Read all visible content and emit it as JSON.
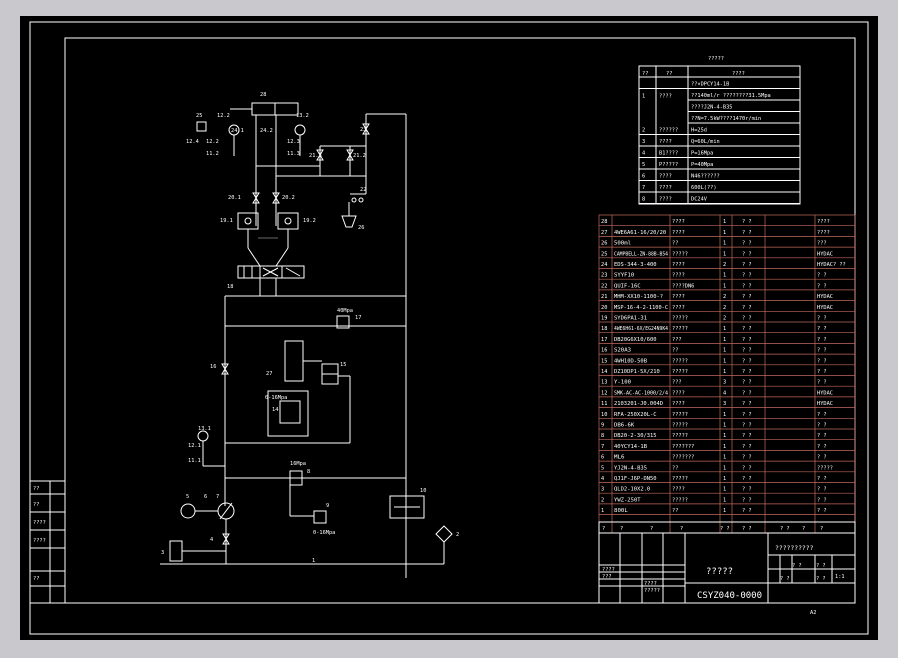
{
  "drawing": {
    "sheet_size": "A2",
    "number": "CSYZ040-0000",
    "title": "?????",
    "subtitle": "??????????"
  },
  "specs": {
    "title": "?????",
    "header": [
      "??",
      "??",
      "????"
    ],
    "rows": [
      {
        "no": "1",
        "name": "????",
        "value": "??×DPCY14-1B"
      },
      {
        "no": "",
        "name": "",
        "value": "??140ml/r ????????31.5Mpa"
      },
      {
        "no": "",
        "name": "",
        "value": "????J2N-4-B35"
      },
      {
        "no": "",
        "name": "",
        "value": "??N=7.5kW????1470r/min"
      },
      {
        "no": "2",
        "name": "??????",
        "value": "H=25d"
      },
      {
        "no": "3",
        "name": "????",
        "value": "Q=60L/min"
      },
      {
        "no": "4",
        "name": "B1????",
        "value": "P=16Mpa"
      },
      {
        "no": "5",
        "name": "P?????",
        "value": "P=40Mpa"
      },
      {
        "no": "6",
        "name": "????",
        "value": "N46??????"
      },
      {
        "no": "7",
        "name": "????",
        "value": "600L(??)"
      },
      {
        "no": "8",
        "name": "????",
        "value": "DC24V"
      }
    ]
  },
  "bom": [
    {
      "no": "28",
      "code": "",
      "name": "????",
      "qty": "1",
      "mat": "? ?",
      "note": "????"
    },
    {
      "no": "27",
      "code": "4WE6A61-16/20/20",
      "name": "????",
      "qty": "1",
      "mat": "? ?",
      "note": "????"
    },
    {
      "no": "26",
      "code": "500ml",
      "name": "??",
      "qty": "1",
      "mat": "? ?",
      "note": "???"
    },
    {
      "no": "25",
      "code": "CAMPBELL-ZN-88B-B54",
      "name": "?????",
      "qty": "1",
      "mat": "? ?",
      "note": "HYDAC"
    },
    {
      "no": "24",
      "code": "EDS-344-3-400",
      "name": "????",
      "qty": "2",
      "mat": "? ?",
      "note": "HYDAC? ??"
    },
    {
      "no": "23",
      "code": "SYYF10",
      "name": "????",
      "qty": "1",
      "mat": "? ?",
      "note": "? ?"
    },
    {
      "no": "22",
      "code": "QUIF-16C",
      "name": "????DN6",
      "qty": "1",
      "mat": "? ?",
      "note": "? ?"
    },
    {
      "no": "21",
      "code": "MHM-XX10-1100-?",
      "name": "????",
      "qty": "2",
      "mat": "? ?",
      "note": "HYDAC"
    },
    {
      "no": "20",
      "code": "MSP-16-4-2-1100-C",
      "name": "????",
      "qty": "2",
      "mat": "? ?",
      "note": "HYDAC"
    },
    {
      "no": "19",
      "code": "SYD6PA1-31",
      "name": "?????",
      "qty": "2",
      "mat": "? ?",
      "note": "? ?"
    },
    {
      "no": "18",
      "code": "4WE6H61-6X/EG24N9K4",
      "name": "?????",
      "qty": "1",
      "mat": "? ?",
      "note": "? ?"
    },
    {
      "no": "17",
      "code": "DB20G6X10/600",
      "name": "???",
      "qty": "1",
      "mat": "? ?",
      "note": "? ?"
    },
    {
      "no": "16",
      "code": "S20A3",
      "name": "??",
      "qty": "1",
      "mat": "? ?",
      "note": "? ?"
    },
    {
      "no": "15",
      "code": "4WH10D-50B",
      "name": "?????",
      "qty": "1",
      "mat": "? ?",
      "note": "? ?"
    },
    {
      "no": "14",
      "code": "DZ10DP1-5X/210",
      "name": "?????",
      "qty": "1",
      "mat": "? ?",
      "note": "? ?"
    },
    {
      "no": "13",
      "code": "Y-100",
      "name": "???",
      "qty": "3",
      "mat": "? ?",
      "note": "? ?"
    },
    {
      "no": "12",
      "code": "SMK-AC-AC-1000/2/4",
      "name": "????",
      "qty": "4",
      "mat": "? ?",
      "note": "HYDAC"
    },
    {
      "no": "11",
      "code": "2103201-J0.004D",
      "name": "????",
      "qty": "3",
      "mat": "? ?",
      "note": "HYDAC"
    },
    {
      "no": "10",
      "code": "RFA-250X20L-C",
      "name": "?????",
      "qty": "1",
      "mat": "? ?",
      "note": "? ?"
    },
    {
      "no": "9",
      "code": "DB6-6K",
      "name": "?????",
      "qty": "1",
      "mat": "? ?",
      "note": "? ?"
    },
    {
      "no": "8",
      "code": "DB20-2-30/315",
      "name": "?????",
      "qty": "1",
      "mat": "? ?",
      "note": "? ?"
    },
    {
      "no": "7",
      "code": "40YCY14-1B",
      "name": "???????",
      "qty": "1",
      "mat": "? ?",
      "note": "? ?"
    },
    {
      "no": "6",
      "code": "ML6",
      "name": "???????",
      "qty": "1",
      "mat": "? ?",
      "note": "? ?"
    },
    {
      "no": "5",
      "code": "YJ2N-4-B35",
      "name": "??",
      "qty": "1",
      "mat": "? ?",
      "note": "?????"
    },
    {
      "no": "4",
      "code": "QJ1F-J6P-DN50",
      "name": "?????",
      "qty": "1",
      "mat": "? ?",
      "note": "? ?"
    },
    {
      "no": "3",
      "code": "QLD2-10X2.0",
      "name": "????",
      "qty": "1",
      "mat": "? ?",
      "note": "? ?"
    },
    {
      "no": "2",
      "code": "YWZ-250T",
      "name": "?????",
      "qty": "1",
      "mat": "? ?",
      "note": "? ?"
    },
    {
      "no": "1",
      "code": "800L",
      "name": "??",
      "qty": "1",
      "mat": "? ?",
      "note": "? ?"
    }
  ],
  "bom_header": [
    "?",
    "?",
    "?",
    "?",
    "? ?",
    "? ?",
    "? ?",
    "?",
    "?"
  ],
  "title_block": {
    "rows_left": [
      "??",
      "??",
      "??",
      "??",
      "??"
    ],
    "misc": [
      "????",
      "???",
      "????",
      "?????"
    ],
    "right": [
      "? ?",
      "? ?",
      "? ?",
      "? ?"
    ],
    "sheet": "1:1",
    "page": "A2"
  },
  "left_block": [
    "??",
    "??",
    "????",
    "????",
    "??"
  ],
  "labels": {
    "l28": "28",
    "l25": "25",
    "l124": "12.4",
    "l122": "12.2",
    "l132": "13.2",
    "l242": "24.2",
    "l241": "24.1",
    "l123": "12.3",
    "l131": "13.1",
    "l121": "12.1",
    "l112": "11.2",
    "l113": "11.3",
    "l213": "21.3",
    "l212": "21.2",
    "l23": "23",
    "l22": "22",
    "l26": "26",
    "l201": "20.1",
    "l202": "20.2",
    "l191": "19.1",
    "l192": "19.2",
    "l18": "18",
    "p40": "40Mpa",
    "l17": "17",
    "l16": "16",
    "l27": "27",
    "l15": "15",
    "p016a": "0-16Mpa",
    "l14": "14",
    "l131b": "13.1",
    "l121b": "12.1",
    "l111": "11.1",
    "p16": "16Mpa",
    "l8": "8",
    "l9": "9",
    "p016b": "0-16Mpa",
    "l10": "10",
    "l5": "5",
    "l6": "6",
    "l7": "7",
    "l4": "4",
    "l3": "3",
    "l1": "1",
    "l2": "2"
  }
}
